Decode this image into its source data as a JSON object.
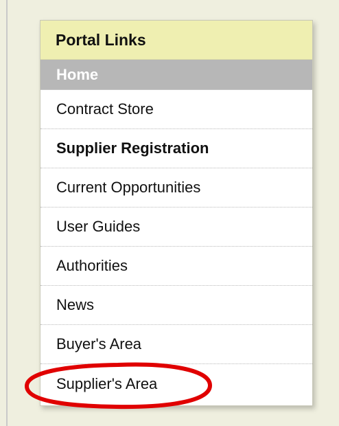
{
  "panel": {
    "title": "Portal Links",
    "items": [
      {
        "label": "Home",
        "state": "active"
      },
      {
        "label": "Contract Store"
      },
      {
        "label": "Supplier Registration",
        "emphasis": "bold"
      },
      {
        "label": "Current Opportunities"
      },
      {
        "label": "User Guides"
      },
      {
        "label": "Authorities"
      },
      {
        "label": "News"
      },
      {
        "label": "Buyer's Area"
      },
      {
        "label": "Supplier's Area",
        "annotation": "red-ellipse-highlight"
      }
    ]
  },
  "colors": {
    "page_background": "#efefdf",
    "header_background": "#efefb1",
    "active_background": "#b7b7b7",
    "highlight_stroke": "#e00000"
  }
}
